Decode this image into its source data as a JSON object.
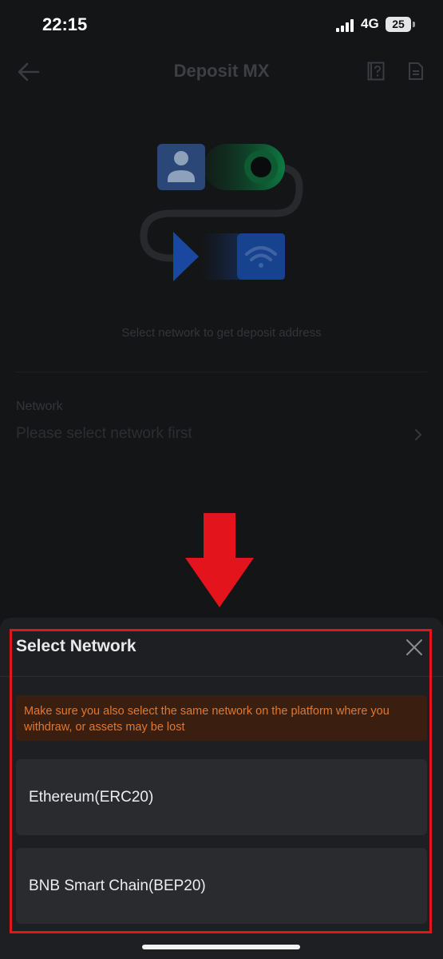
{
  "status_bar": {
    "time": "22:15",
    "network": "4G",
    "battery": "25"
  },
  "header": {
    "title": "Deposit MX",
    "icons": [
      "back-arrow-icon",
      "faq-icon",
      "records-icon"
    ]
  },
  "main": {
    "hint": "Select network to get deposit address",
    "network_label": "Network",
    "network_placeholder": "Please select network first"
  },
  "sheet": {
    "title": "Select Network",
    "warning": "Make sure you also select the same network on the platform where you withdraw, or assets may be lost",
    "options": [
      {
        "label": "Ethereum(ERC20)"
      },
      {
        "label": "BNB Smart Chain(BEP20)"
      }
    ]
  },
  "colors": {
    "background": "#141517",
    "sheet": "#1e1f22",
    "option": "#2a2b2f",
    "warning_bg": "#3a1f10",
    "warning_text": "#e0782d",
    "annotation_red": "#e4141d"
  }
}
